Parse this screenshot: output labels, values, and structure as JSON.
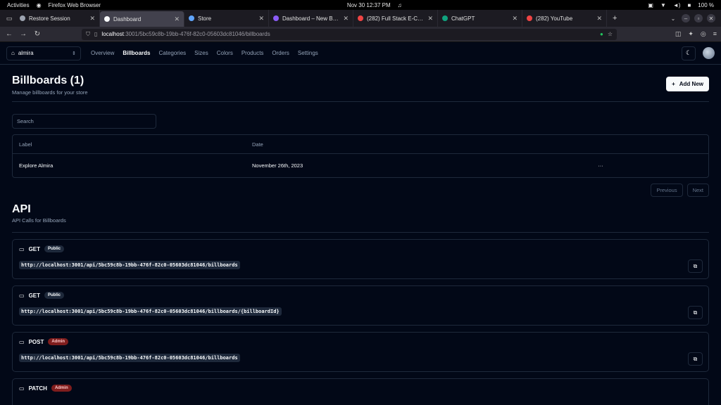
{
  "system": {
    "activities": "Activities",
    "browser_name": "Firefox Web Browser",
    "datetime": "Nov 30  12:37 PM",
    "battery": "100 %"
  },
  "tabs": [
    {
      "title": "Restore Session",
      "fav_color": "#9ca3af"
    },
    {
      "title": "Dashboard",
      "fav_color": "#f8fafc"
    },
    {
      "title": "Store",
      "fav_color": "#60a5fa"
    },
    {
      "title": "Dashboard – New Busine",
      "fav_color": "#8b5cf6"
    },
    {
      "title": "(282) Full Stack E-Comm",
      "fav_color": "#ef4444"
    },
    {
      "title": "ChatGPT",
      "fav_color": "#10a37f"
    },
    {
      "title": "(282) YouTube",
      "fav_color": "#ef4444"
    }
  ],
  "url": {
    "host": "localhost",
    "path": ":3001/5bc59c8b-19bb-476f-82c0-05603dc81046/billboards"
  },
  "header": {
    "store_name": "almira",
    "nav": [
      "Overview",
      "Billboards",
      "Categories",
      "Sizes",
      "Colors",
      "Products",
      "Orders",
      "Settings"
    ],
    "active_nav": "Billboards"
  },
  "page": {
    "title": "Billboards (1)",
    "subtitle": "Manage billboards for your store",
    "add_label": "Add New",
    "search_placeholder": "Search"
  },
  "table": {
    "columns": [
      "Label",
      "Date"
    ],
    "rows": [
      {
        "label": "Explore Almira",
        "date": "November 26th, 2023",
        "actions": "···"
      }
    ]
  },
  "pager": {
    "prev": "Previous",
    "next": "Next"
  },
  "api": {
    "title": "API",
    "subtitle": "API Calls for Billboards",
    "endpoints": [
      {
        "method": "GET",
        "access": "Public",
        "url": "http://localhost:3001/api/5bc59c8b-19bb-476f-82c0-05603dc81046/billboards"
      },
      {
        "method": "GET",
        "access": "Public",
        "url": "http://localhost:3001/api/5bc59c8b-19bb-476f-82c0-05603dc81046/billboards/{billboardId}"
      },
      {
        "method": "POST",
        "access": "Admin",
        "url": "http://localhost:3001/api/5bc59c8b-19bb-476f-82c0-05603dc81046/billboards"
      },
      {
        "method": "PATCH",
        "access": "Admin",
        "url": ""
      }
    ]
  }
}
